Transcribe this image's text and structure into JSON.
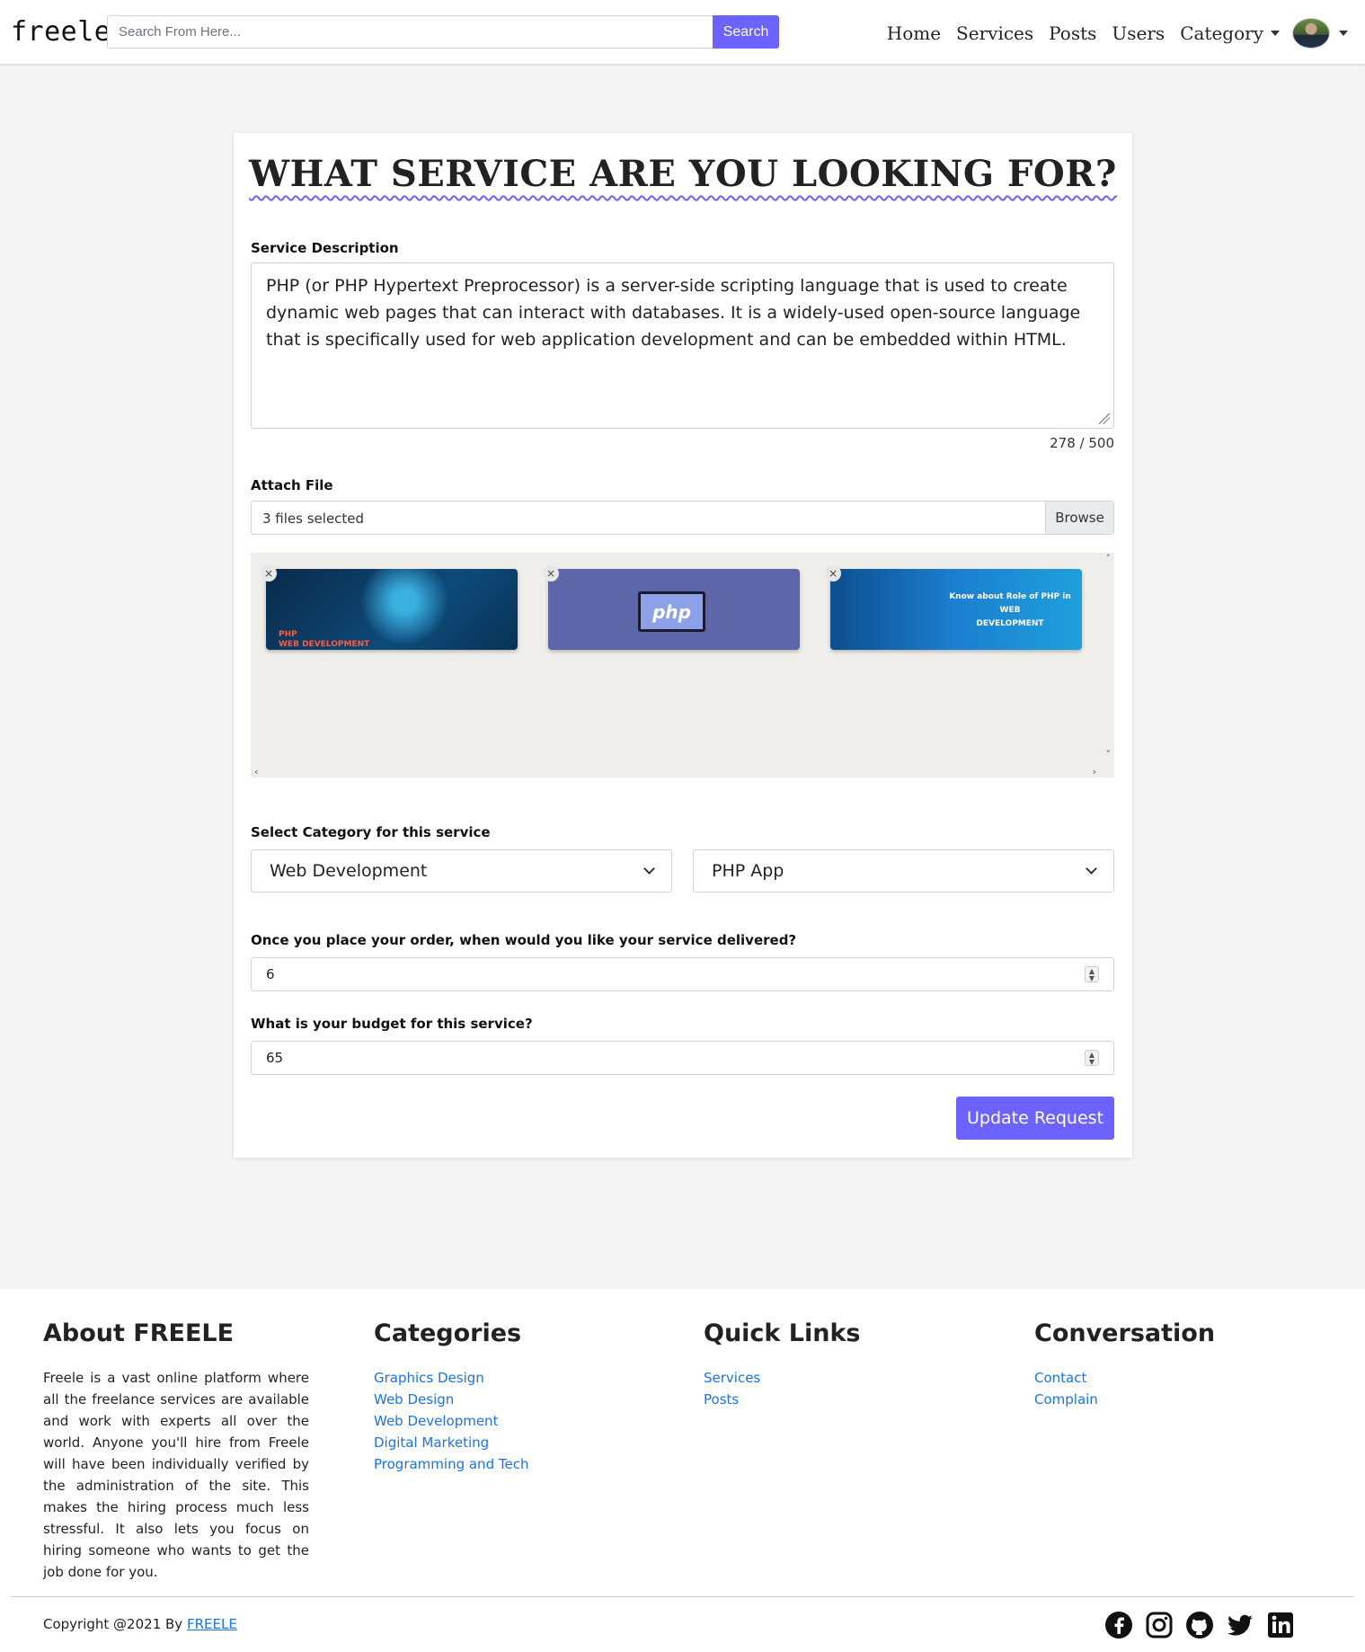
{
  "navbar": {
    "brand": "freele",
    "search_placeholder": "Search From Here...",
    "search_button": "Search",
    "links": [
      "Home",
      "Services",
      "Posts",
      "Users",
      "Category"
    ]
  },
  "form": {
    "title": "WHAT SERVICE ARE YOU LOOKING FOR?",
    "description_label": "Service Description",
    "description_value": "PHP (or PHP Hypertext Preprocessor) is a server-side scripting language that is used to create dynamic web pages that can interact with databases. It is a widely-used open-source language that is specifically used for web application development and can be embedded within HTML.",
    "char_counter": "278 / 500",
    "attach_label": "Attach File",
    "file_text": "3 files selected",
    "browse_button": "Browse",
    "previews": [
      {
        "icon": "php-web-development-thumbnail",
        "caption": "PHP\nWEB DEVELOPMENT"
      },
      {
        "icon": "php-code-monitor-thumbnail",
        "caption": "php"
      },
      {
        "icon": "role-of-php-web-development-thumbnail",
        "caption": "Know about Role of PHP in\nWEB\nDEVELOPMENT"
      }
    ],
    "category_label": "Select Category for this service",
    "category_value": "Web Development",
    "subcategory_value": "PHP App",
    "delivery_label": "Once you place your order, when would you like your service delivered?",
    "delivery_value": "6",
    "budget_label": "What is your budget for this service?",
    "budget_value": "65",
    "submit_button": "Update Request"
  },
  "footer": {
    "about_title": "About FREELE",
    "about_text": "Freele is a vast online platform where all the freelance services are available and work with experts all over the world. Anyone you'll hire from Freele will have been individually verified by the administration of the site. This makes the hiring process much less stressful. It also lets you focus on hiring someone who wants to get the job done for you.",
    "categories_title": "Categories",
    "categories": [
      "Graphics Design",
      "Web Design",
      "Web Development",
      "Digital Marketing",
      "Programming and Tech"
    ],
    "quick_title": "Quick Links",
    "quick_links": [
      "Services",
      "Posts"
    ],
    "conv_title": "Conversation",
    "conv_links": [
      "Contact",
      "Complain"
    ],
    "copyright_prefix": "Copyright @2021 By ",
    "copyright_link": "FREELE",
    "socials": [
      "facebook-icon",
      "instagram-icon",
      "github-icon",
      "twitter-icon",
      "linkedin-icon"
    ]
  },
  "colors": {
    "accent": "#6c63ff",
    "link": "#1a73e8"
  }
}
